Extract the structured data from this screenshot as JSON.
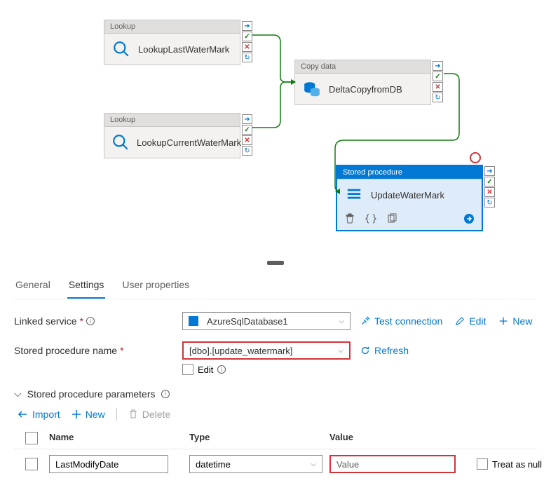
{
  "activities": {
    "lookup1": {
      "type": "Lookup",
      "name": "LookupLastWaterMark"
    },
    "lookup2": {
      "type": "Lookup",
      "name": "LookupCurrentWaterMark"
    },
    "copy": {
      "type": "Copy data",
      "name": "DeltaCopyfromDB"
    },
    "sproc": {
      "type": "Stored procedure",
      "name": "UpdateWaterMark"
    }
  },
  "tabs": {
    "general": "General",
    "settings": "Settings",
    "user_props": "User properties"
  },
  "form": {
    "linked_service_label": "Linked service",
    "linked_service_value": "AzureSqlDatabase1",
    "sproc_name_label": "Stored procedure name",
    "sproc_name_value": "[dbo].[update_watermark]",
    "edit_label": "Edit",
    "test_connection": "Test connection",
    "edit_action": "Edit",
    "new_action": "New",
    "refresh": "Refresh"
  },
  "params": {
    "section_label": "Stored procedure parameters",
    "import": "Import",
    "new": "New",
    "delete": "Delete",
    "headers": {
      "name": "Name",
      "type": "Type",
      "value": "Value"
    },
    "rows": [
      {
        "name": "LastModifyDate",
        "type": "datetime",
        "value_placeholder": "Value",
        "treat_null_label": "Treat as null"
      }
    ]
  }
}
